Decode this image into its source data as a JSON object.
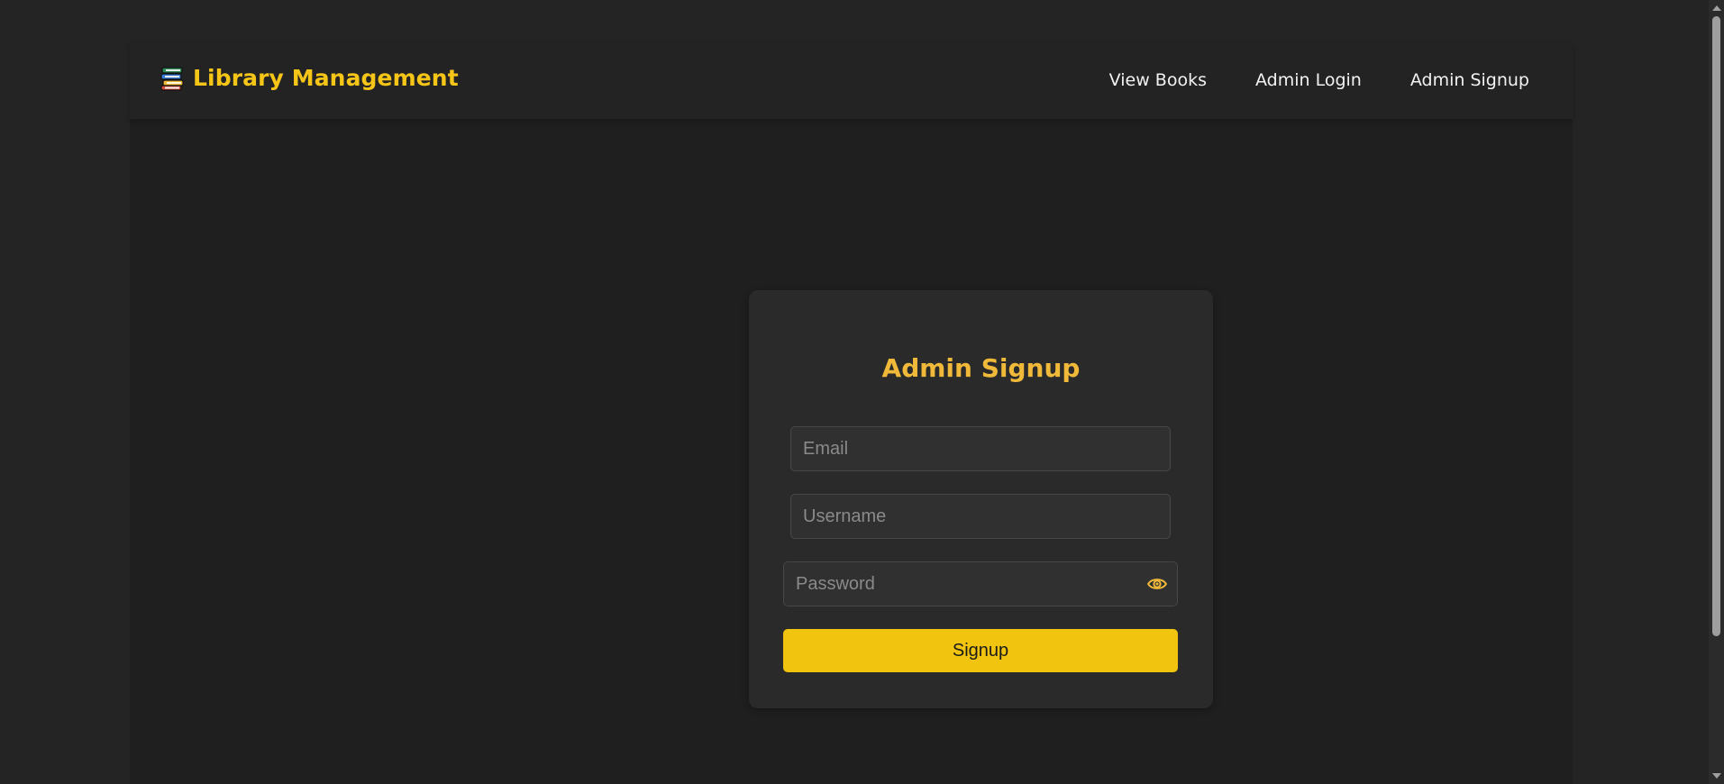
{
  "navbar": {
    "brand_icon": "books-icon",
    "brand_text": "Library Management",
    "links": [
      {
        "label": "View Books"
      },
      {
        "label": "Admin Login"
      },
      {
        "label": "Admin Signup"
      }
    ]
  },
  "form": {
    "title": "Admin Signup",
    "email": {
      "placeholder": "Email",
      "value": ""
    },
    "username": {
      "placeholder": "Username",
      "value": ""
    },
    "password": {
      "placeholder": "Password",
      "value": "",
      "toggle_icon": "eye-icon"
    },
    "submit_label": "Signup"
  },
  "colors": {
    "accent": "#f5c518",
    "title": "#f0b93a",
    "button": "#f1c40f",
    "background": "#242424",
    "card": "#2a2a2a"
  }
}
